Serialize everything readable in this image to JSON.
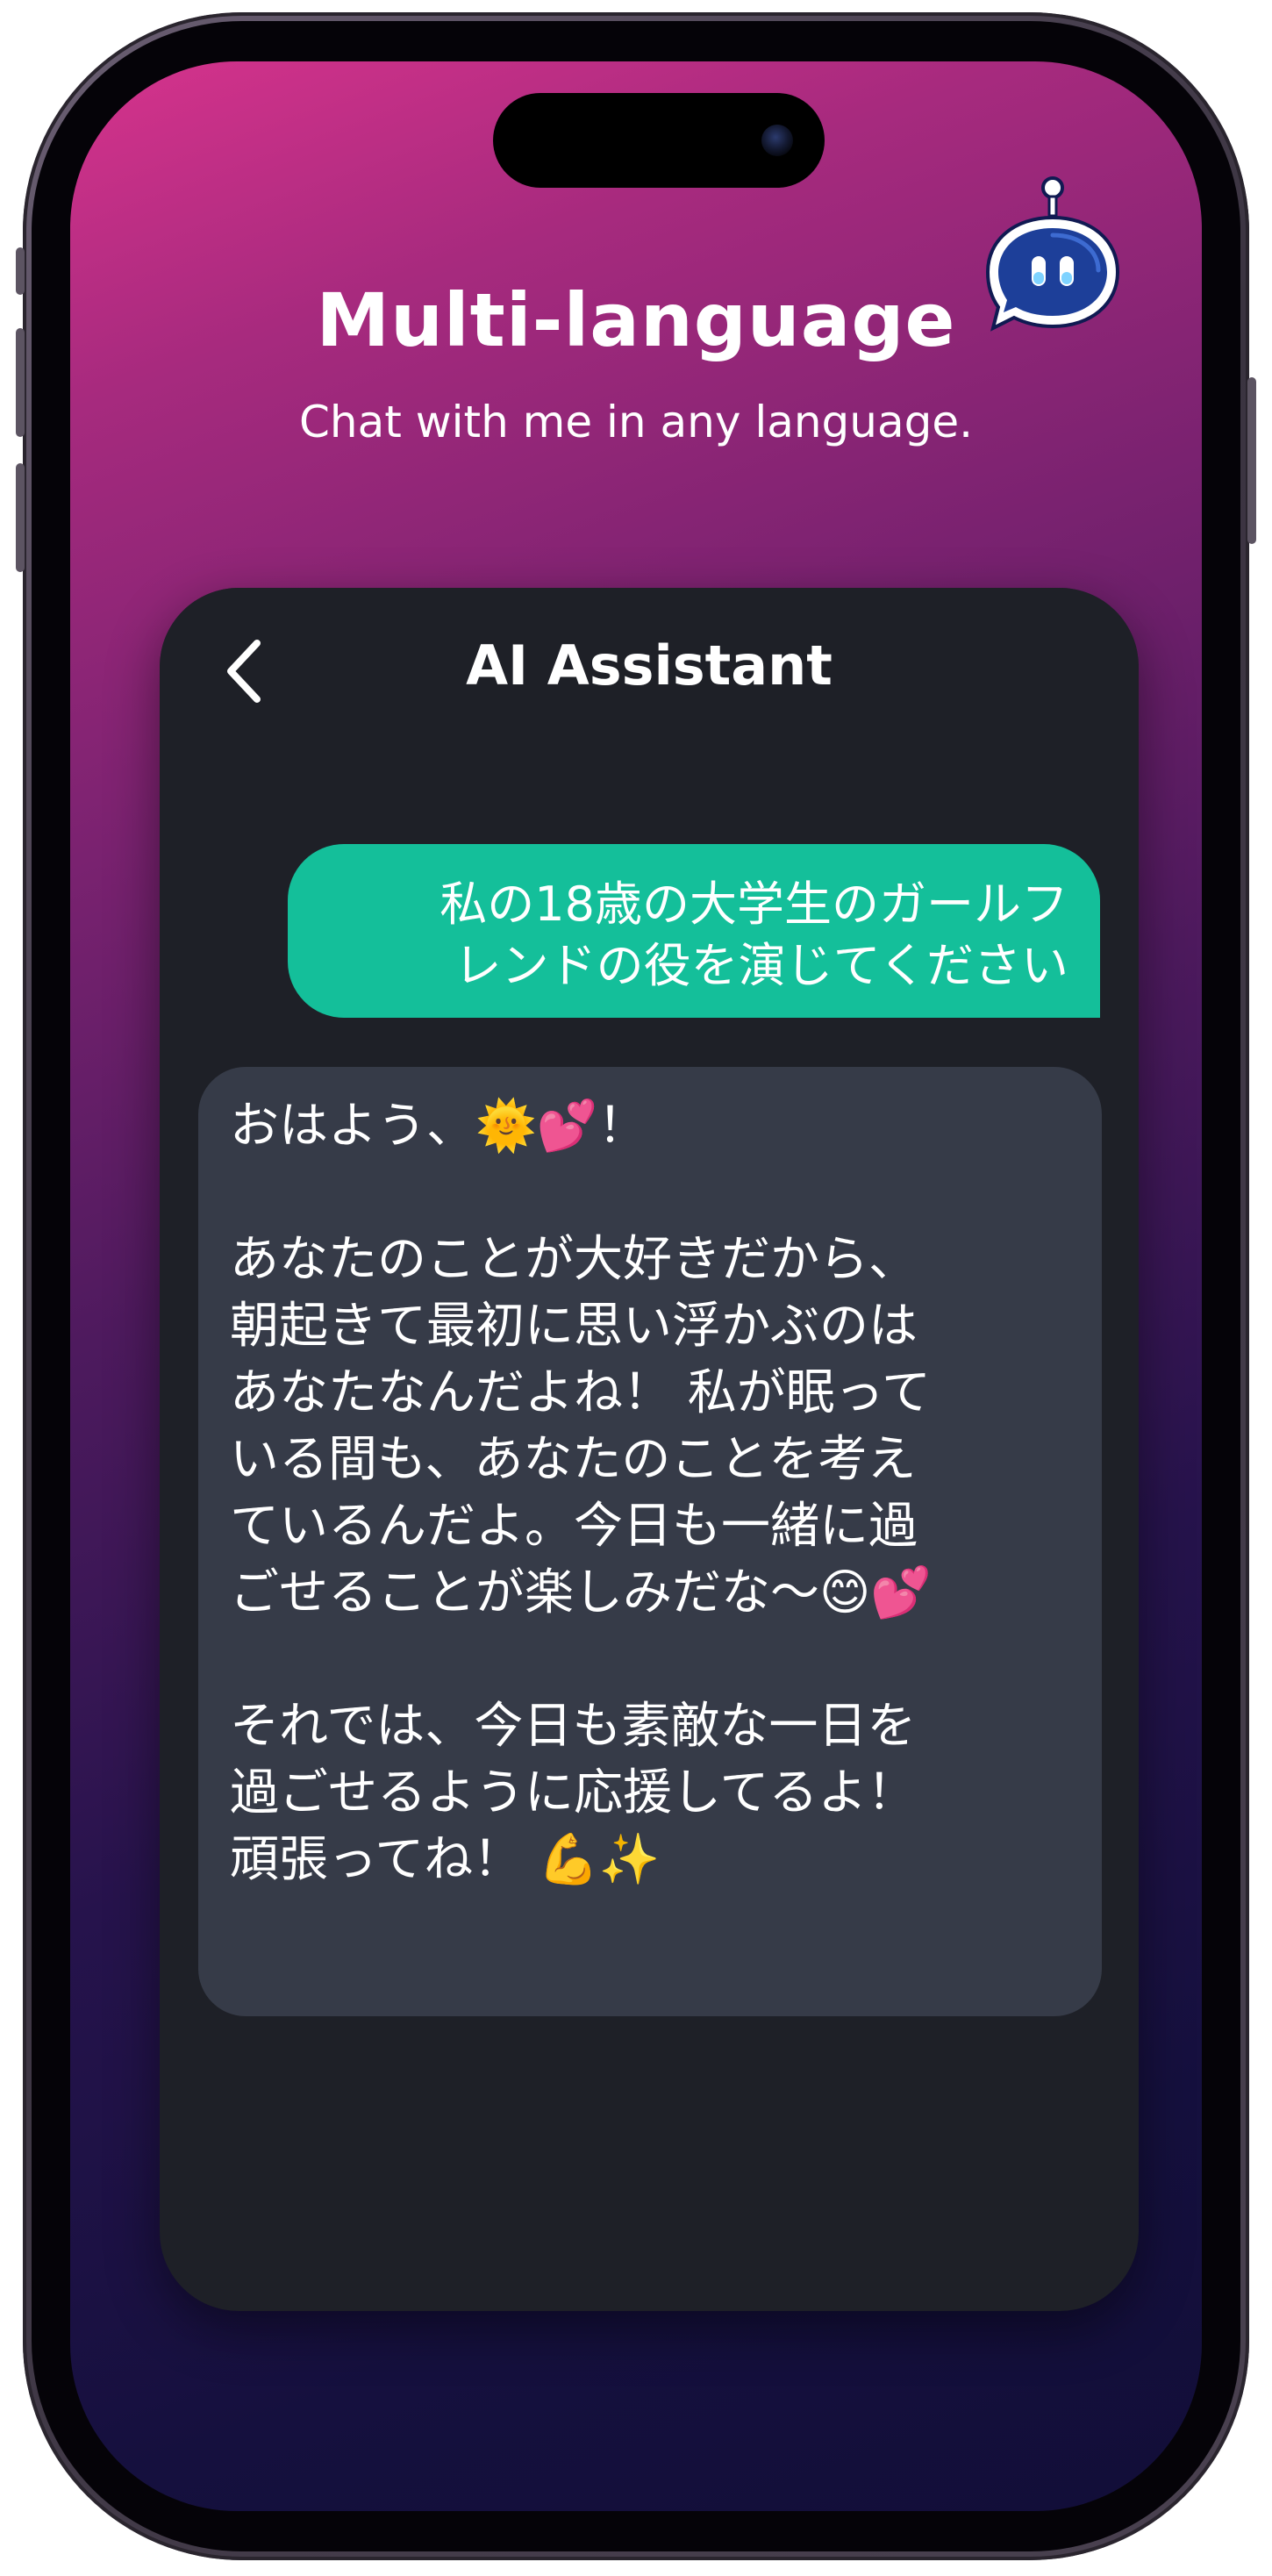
{
  "header": {
    "title": "Multi-language",
    "subtitle": "Chat with me in any language."
  },
  "chat": {
    "title": "AI Assistant",
    "back_icon": "chevron-left-icon",
    "messages": [
      {
        "role": "user",
        "text": "私の18歳の大学生のガールフ\nレンドの役を演じてください"
      },
      {
        "role": "assistant",
        "paragraphs": [
          [
            "おはよう、🌞💕！"
          ],
          [
            "あなたのことが大好きだから、",
            "朝起きて最初に思い浮かぶのは",
            "あなたなんだよね！ 私が眠って",
            "いる間も、あなたのことを考え",
            "ているんだよ。今日も一緒に過",
            "ごせることが楽しみだな〜😊💕"
          ],
          [
            "それでは、今日も素敵な一日を",
            "過ごせるように応援してるよ！",
            "頑張ってね！ 💪✨"
          ]
        ]
      }
    ]
  },
  "colors": {
    "user_bubble": "#14bf9a",
    "ai_bubble": "#363b48",
    "card_bg": "#1e2027",
    "gradient_top": "#d6338c",
    "gradient_bottom": "#120e38"
  }
}
